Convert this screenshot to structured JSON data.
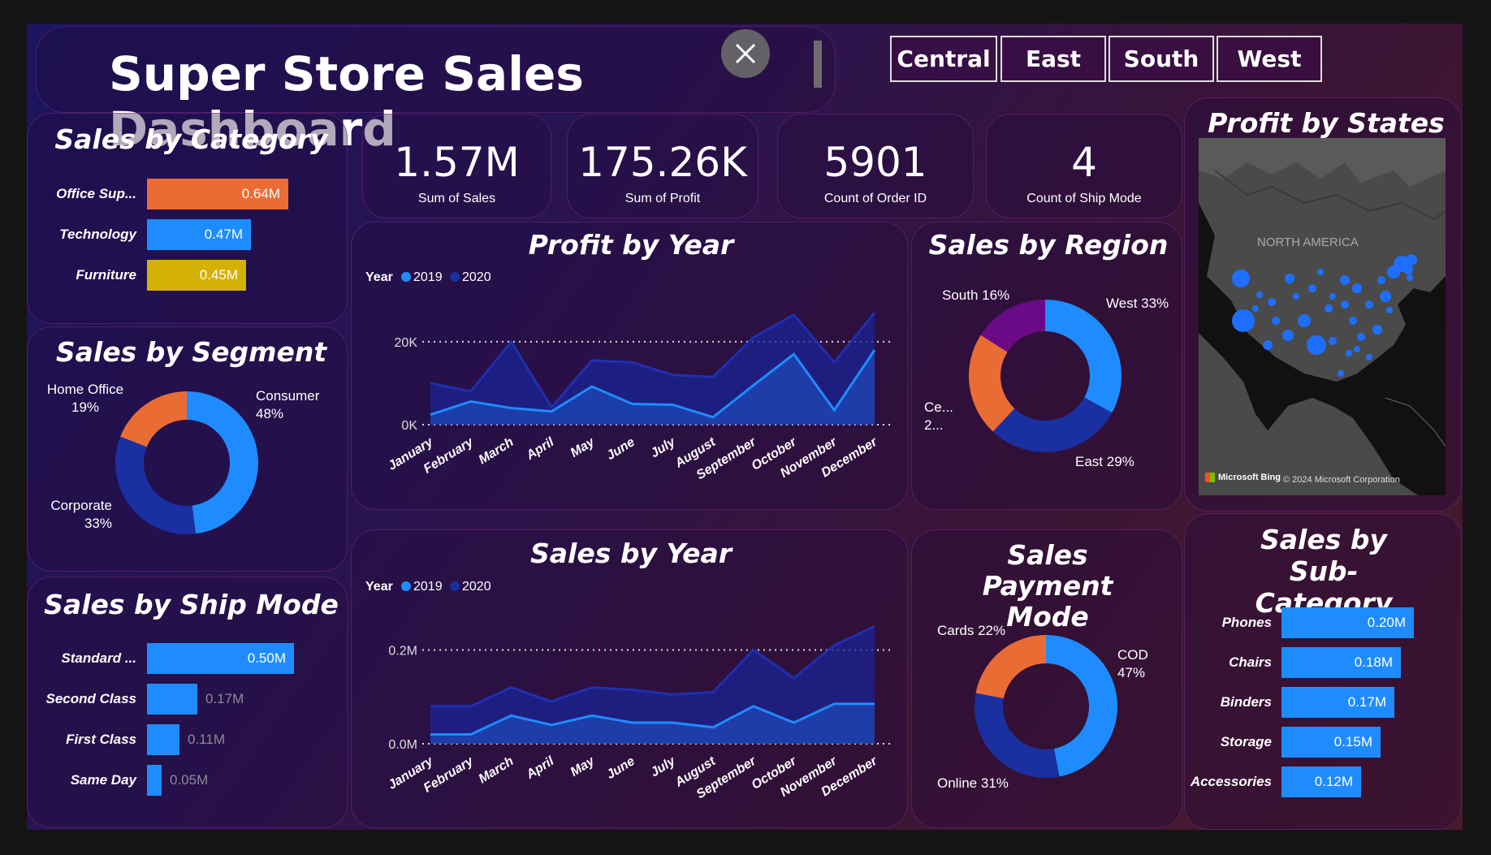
{
  "header": {
    "title": "Super Store Sales Dashboard"
  },
  "region_filters": [
    "Central",
    "East",
    "South",
    "West"
  ],
  "kpis": [
    {
      "value": "1.57M",
      "label": "Sum of Sales"
    },
    {
      "value": "175.26K",
      "label": "Sum of Profit"
    },
    {
      "value": "5901",
      "label": "Count of Order ID"
    },
    {
      "value": "4",
      "label": "Count of Ship Mode"
    }
  ],
  "colors": {
    "accent_blue": "#1e8cff",
    "dark_blue": "#1a2fa0",
    "orange": "#ea6c35",
    "yellow": "#d4b106",
    "purple": "#6a0a86"
  },
  "sales_by_category": {
    "title": "Sales by Category",
    "items": [
      {
        "label": "Office Sup...",
        "value": 0.64,
        "display": "0.64M",
        "color": "#ea6c35"
      },
      {
        "label": "Technology",
        "value": 0.47,
        "display": "0.47M",
        "color": "#1e8cff"
      },
      {
        "label": "Furniture",
        "value": 0.45,
        "display": "0.45M",
        "color": "#d4b106"
      }
    ]
  },
  "sales_by_segment": {
    "title": "Sales by Segment",
    "slices": [
      {
        "label": "Consumer",
        "pct": "48%",
        "value": 48,
        "color": "#1e8cff"
      },
      {
        "label": "Corporate",
        "pct": "33%",
        "value": 33,
        "color": "#1a2fa0"
      },
      {
        "label": "Home Office",
        "pct": "19%",
        "value": 19,
        "color": "#ea6c35"
      }
    ]
  },
  "sales_by_ship_mode": {
    "title": "Sales by Ship Mode",
    "items": [
      {
        "label": "Standard ...",
        "value": 0.5,
        "display": "0.50M"
      },
      {
        "label": "Second Class",
        "value": 0.17,
        "display": "0.17M"
      },
      {
        "label": "First Class",
        "value": 0.11,
        "display": "0.11M"
      },
      {
        "label": "Same Day",
        "value": 0.05,
        "display": "0.05M"
      }
    ]
  },
  "profit_by_year": {
    "title": "Profit by Year",
    "legend_title": "Year",
    "yticks": [
      "20K",
      "0K"
    ]
  },
  "sales_by_year": {
    "title": "Sales by Year",
    "legend_title": "Year",
    "yticks": [
      "0.2M",
      "0.0M"
    ]
  },
  "chart_data": [
    {
      "type": "area",
      "title": "Profit by Year",
      "x": [
        "January",
        "February",
        "March",
        "April",
        "May",
        "June",
        "July",
        "August",
        "September",
        "October",
        "November",
        "December"
      ],
      "series": [
        {
          "name": "2019",
          "values": [
            2400,
            5600,
            4000,
            3200,
            9200,
            5000,
            4800,
            1800,
            9500,
            17000,
            3500,
            18000
          ]
        },
        {
          "name": "2020",
          "values": [
            10000,
            8000,
            20000,
            4200,
            15500,
            15000,
            12000,
            11500,
            21000,
            26500,
            15000,
            27000
          ]
        }
      ],
      "yticks": [
        0,
        20000
      ],
      "ylim": [
        0,
        28000
      ]
    },
    {
      "type": "area",
      "title": "Sales by Year",
      "x": [
        "January",
        "February",
        "March",
        "April",
        "May",
        "June",
        "July",
        "August",
        "September",
        "October",
        "November",
        "December"
      ],
      "series": [
        {
          "name": "2019",
          "values": [
            0.02,
            0.02,
            0.06,
            0.04,
            0.06,
            0.045,
            0.045,
            0.035,
            0.08,
            0.045,
            0.085,
            0.085
          ]
        },
        {
          "name": "2020",
          "values": [
            0.08,
            0.08,
            0.12,
            0.09,
            0.12,
            0.115,
            0.105,
            0.11,
            0.2,
            0.14,
            0.21,
            0.25
          ]
        }
      ],
      "yticks": [
        0,
        0.2
      ],
      "ylim": [
        0,
        0.27
      ]
    }
  ],
  "sales_by_region": {
    "title": "Sales by Region",
    "slices": [
      {
        "label": "West 33%",
        "value": 33,
        "color": "#1e8cff"
      },
      {
        "label": "East 29%",
        "value": 29,
        "color": "#1a2fa0"
      },
      {
        "label": "Ce...\n2...",
        "value": 22,
        "color": "#ea6c35"
      },
      {
        "label": "South 16%",
        "value": 16,
        "color": "#6a0a86"
      }
    ]
  },
  "sales_payment_mode": {
    "title": "Sales Payment Mode",
    "slices": [
      {
        "label": "COD 47%",
        "value": 47,
        "color": "#1e8cff"
      },
      {
        "label": "Online 31%",
        "value": 31,
        "color": "#1a2fa0"
      },
      {
        "label": "Cards 22%",
        "value": 22,
        "color": "#ea6c35"
      }
    ]
  },
  "profit_by_states": {
    "title": "Profit by States",
    "map_label": "NORTH AMERICA",
    "bing_label": "Microsoft Bing",
    "copyright": "© 2024 Microsoft Corporation"
  },
  "sales_by_subcategory": {
    "title": "Sales by Sub-Category",
    "items": [
      {
        "label": "Phones",
        "value": 0.2,
        "display": "0.20M"
      },
      {
        "label": "Chairs",
        "value": 0.18,
        "display": "0.18M"
      },
      {
        "label": "Binders",
        "value": 0.17,
        "display": "0.17M"
      },
      {
        "label": "Storage",
        "value": 0.15,
        "display": "0.15M"
      },
      {
        "label": "Accessories",
        "value": 0.12,
        "display": "0.12M"
      }
    ]
  }
}
